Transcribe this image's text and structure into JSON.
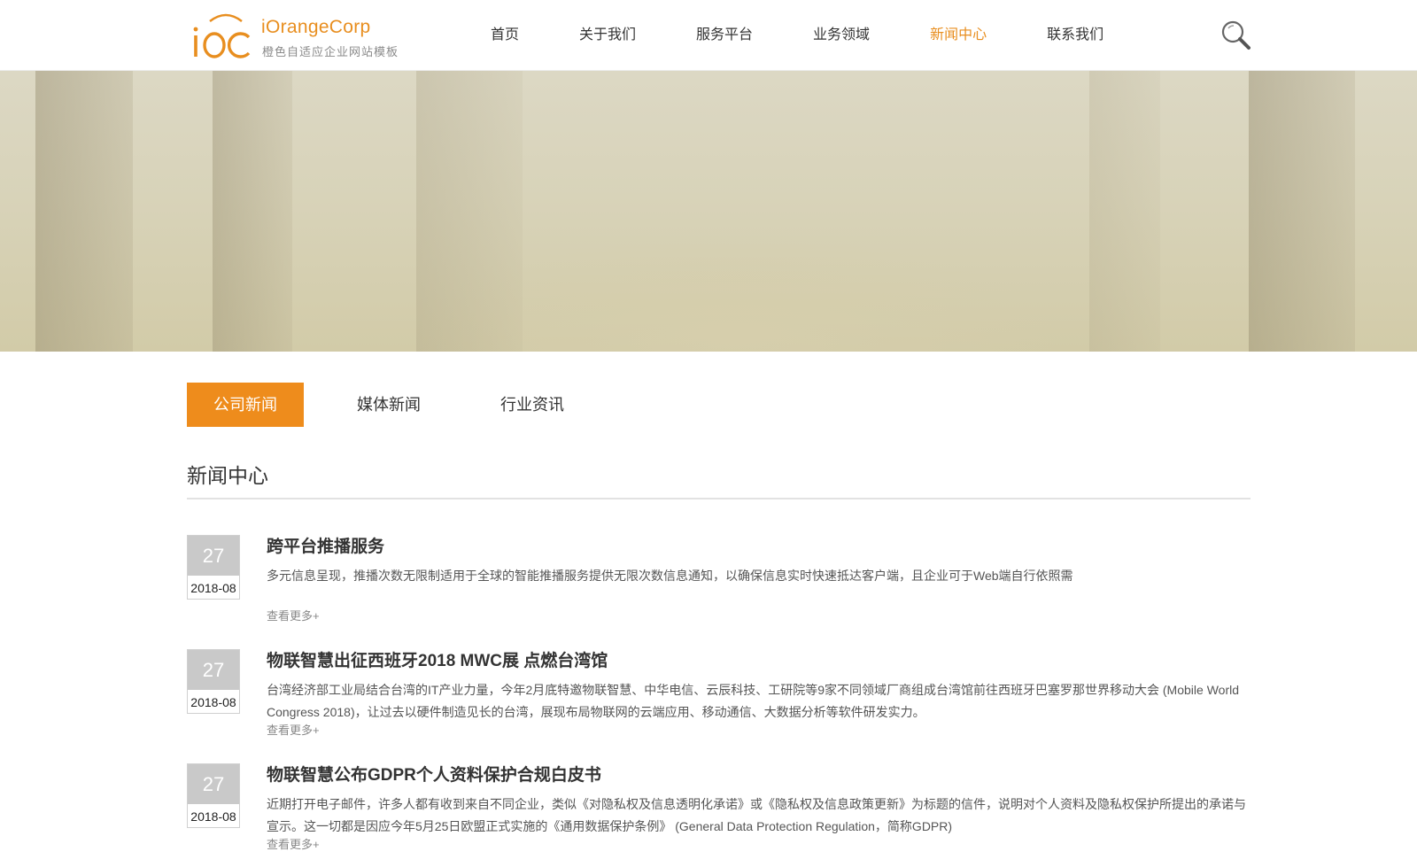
{
  "logo": {
    "mark_text": "iOC",
    "name": "iOrangeCorp",
    "subtitle": "橙色自适应企业网站模板"
  },
  "nav": {
    "items": [
      {
        "label": "首页"
      },
      {
        "label": "关于我们"
      },
      {
        "label": "服务平台"
      },
      {
        "label": "业务领域"
      },
      {
        "label": "新闻中心",
        "active": true
      },
      {
        "label": "联系我们"
      }
    ],
    "search_icon": "search-icon"
  },
  "tabs": [
    {
      "label": "公司新闻",
      "active": true
    },
    {
      "label": "媒体新闻"
    },
    {
      "label": "行业资讯"
    }
  ],
  "section": {
    "title": "新闻中心"
  },
  "news": [
    {
      "day": "27",
      "year_month": "2018-08",
      "title": "跨平台推播服务",
      "description": "多元信息呈现，推播次数无限制适用于全球的智能推播服务提供无限次数信息通知，以确保信息实时快速抵达客户端，且企业可于Web端自行依照需",
      "more": "查看更多+"
    },
    {
      "day": "27",
      "year_month": "2018-08",
      "title": "物联智慧出征西班牙2018 MWC展 点燃台湾馆",
      "description": "台湾经济部工业局结合台湾的IT产业力量，今年2月底特邀物联智慧、中华电信、云辰科技、工研院等9家不同领域厂商组成台湾馆前往西班牙巴塞罗那世界移动大会 (Mobile World Congress 2018)，让过去以硬件制造见长的台湾，展现布局物联网的云端应用、移动通信、大数据分析等软件研发实力。",
      "more": "查看更多+"
    },
    {
      "day": "27",
      "year_month": "2018-08",
      "title": "物联智慧公布GDPR个人资料保护合规白皮书",
      "description": "近期打开电子邮件，许多人都有收到来自不同企业，类似《对隐私权及信息透明化承诺》或《隐私权及信息政策更新》为标题的信件，说明对个人资料及隐私权保护所提出的承诺与宣示。这一切都是因应今年5月25日欧盟正式实施的《通用数据保护条例》 (General Data Protection Regulation，简称GDPR)",
      "more": "查看更多+"
    }
  ],
  "colors": {
    "accent": "#ee8c1c",
    "nav_active": "#e88e1f",
    "date_day_bg": "#c9c9c9",
    "banner_tone": "#d8d3b9"
  }
}
